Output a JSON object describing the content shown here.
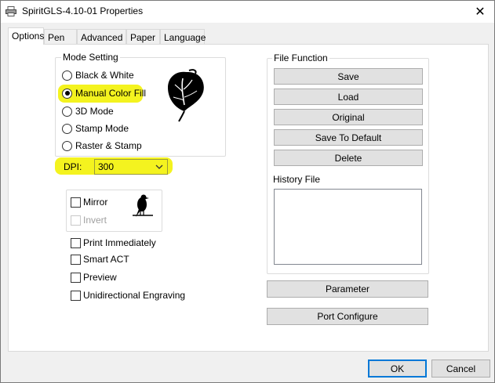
{
  "window": {
    "title": "SpiritGLS-4.10-01 Properties",
    "close_glyph": "✕"
  },
  "tabs": [
    {
      "label": "Options",
      "active": true
    },
    {
      "label": "Pen",
      "active": false
    },
    {
      "label": "Advanced",
      "active": false
    },
    {
      "label": "Paper",
      "active": false
    },
    {
      "label": "Language",
      "active": false
    }
  ],
  "mode_setting": {
    "label": "Mode Setting",
    "options": [
      {
        "label": "Black & White",
        "selected": false
      },
      {
        "label": "Manual Color Fill",
        "selected": true
      },
      {
        "label": "3D Mode",
        "selected": false
      },
      {
        "label": "Stamp Mode",
        "selected": false
      },
      {
        "label": "Raster & Stamp",
        "selected": false
      }
    ],
    "preview_icon": "anthurium-leaf-icon"
  },
  "dpi": {
    "label": "DPI:",
    "value": "300"
  },
  "mirror_group": {
    "mirror_label": "Mirror",
    "invert_label": "Invert",
    "preview_icon": "bird-icon"
  },
  "options": {
    "print_immediately": "Print Immediately",
    "smart_act": "Smart ACT",
    "preview": "Preview",
    "unidirectional": "Unidirectional Engraving"
  },
  "file_function": {
    "label": "File Function",
    "save": "Save",
    "load": "Load",
    "original": "Original",
    "save_default": "Save To Default",
    "delete": "Delete",
    "history_label": "History File"
  },
  "buttons": {
    "parameter": "Parameter",
    "port_configure": "Port Configure",
    "ok": "OK",
    "cancel": "Cancel"
  },
  "colors": {
    "highlight": "#f4f31f",
    "default_button_border": "#0078d7"
  }
}
